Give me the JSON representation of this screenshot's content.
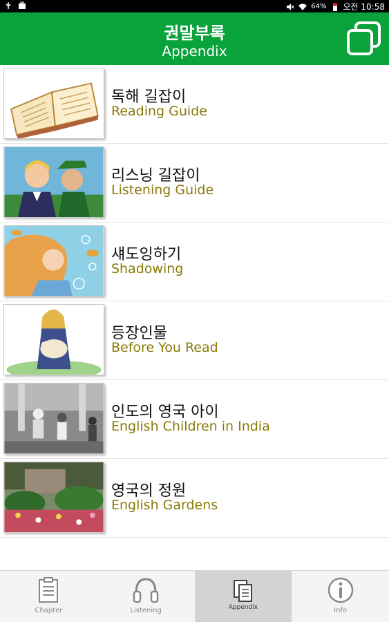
{
  "status_bar": {
    "battery": "64%",
    "time": "오전 10:58"
  },
  "header": {
    "title_ko": "권말부록",
    "title_en": "Appendix",
    "action_icon": "copy-icon"
  },
  "items": [
    {
      "ko": "독해 길잡이",
      "en": "Reading Guide",
      "thumb": "open-book"
    },
    {
      "ko": "리스닝 길잡이",
      "en": "Listening Guide",
      "thumb": "two-figures"
    },
    {
      "ko": "섀도잉하기",
      "en": "Shadowing",
      "thumb": "girl-underwater"
    },
    {
      "ko": "등장인물",
      "en": "Before You Read",
      "thumb": "girl-with-lamb"
    },
    {
      "ko": "인도의 영국 아이",
      "en": "English Children in India",
      "thumb": "old-photo"
    },
    {
      "ko": "영국의 정원",
      "en": "English Gardens",
      "thumb": "garden-photo"
    }
  ],
  "nav": [
    {
      "label": "Chapter",
      "icon": "clipboard-icon",
      "active": false
    },
    {
      "label": "Listening",
      "icon": "headphones-icon",
      "active": false
    },
    {
      "label": "Appendix",
      "icon": "documents-icon",
      "active": true
    },
    {
      "label": "Info",
      "icon": "info-icon",
      "active": false
    }
  ],
  "colors": {
    "header_bg": "#0aa23a",
    "subtitle": "#8a7a08",
    "active_tab": "#d3d3d3"
  }
}
